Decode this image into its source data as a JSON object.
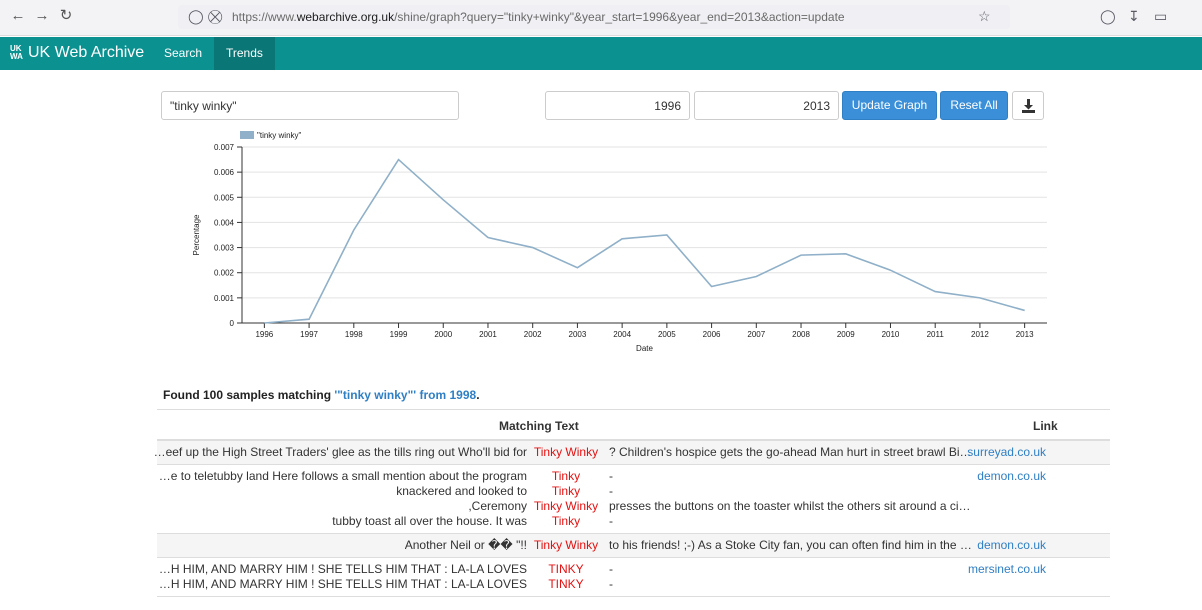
{
  "browser": {
    "url_prefix": "https://www.",
    "url_domain": "webarchive.org.uk",
    "url_suffix": "/shine/graph?query=\"tinky+winky\"&year_start=1996&year_end=2013&action=update"
  },
  "app": {
    "brand": "UK Web Archive",
    "brand_logo": "UK WA",
    "nav": [
      "Search",
      "Trends"
    ]
  },
  "controls": {
    "query": "\"tinky winky\"",
    "year_start": "1996",
    "year_end": "2013",
    "update_label": "Update Graph",
    "reset_label": "Reset All"
  },
  "chart_data": {
    "type": "line",
    "xlabel": "Date",
    "ylabel": "Percentage",
    "ylim": [
      0,
      0.007
    ],
    "yticks": [
      "0",
      "0.001",
      "0.002",
      "0.003",
      "0.004",
      "0.005",
      "0.006",
      "0.007"
    ],
    "categories": [
      "1996",
      "1997",
      "1998",
      "1999",
      "2000",
      "2001",
      "2002",
      "2003",
      "2004",
      "2005",
      "2006",
      "2007",
      "2008",
      "2009",
      "2010",
      "2011",
      "2012",
      "2013"
    ],
    "series": [
      {
        "name": "\"tinky winky\"",
        "color": "#8fb0c8",
        "values": [
          0.0,
          0.00015,
          0.0037,
          0.0065,
          0.0049,
          0.0034,
          0.003,
          0.0022,
          0.00335,
          0.0035,
          0.00145,
          0.00185,
          0.0027,
          0.00275,
          0.0021,
          0.00125,
          0.001,
          0.0005
        ]
      }
    ],
    "grid": true,
    "legend": "top-left"
  },
  "results": {
    "found_prefix": "Found 100 samples matching ",
    "found_query": "'\"tinky winky\"' from 1998",
    "found_suffix": ".",
    "col_text": "Matching Text",
    "col_link": "Link",
    "rows": [
      {
        "link": "surreyad.co.uk",
        "lines": [
          {
            "pre": "…eef up the High Street Traders' glee as the tills ring out Who'll bid for",
            "hit": "Tinky Winky",
            "post": "? Children's hospice gets the go-ahead Man hurt in street brawl Bis…"
          }
        ]
      },
      {
        "link": "demon.co.uk",
        "lines": [
          {
            "pre": "…e to teletubby land Here follows a small mention about the program",
            "hit": "Tinky",
            "post": "-"
          },
          {
            "pre": "knackered and looked to",
            "hit": "Tinky",
            "post": "-"
          },
          {
            "pre": ",Ceremony",
            "hit": "Tinky Winky",
            "post": "presses the buttons on the toaster whilst the others sit around a circ…"
          },
          {
            "pre": "tubby toast all over the house. It was",
            "hit": "Tinky",
            "post": "-"
          }
        ]
      },
      {
        "link": "demon.co.uk",
        "lines": [
          {
            "pre": "Another Neil or �� \"!!",
            "hit": "Tinky Winky",
            "post": "to his friends! ;-) As a Stoke City fan, you can often find him in the E…"
          }
        ]
      },
      {
        "link": "mersinet.co.uk",
        "lines": [
          {
            "pre": "…H HIM, AND MARRY HIM ! SHE TELLS HIM THAT : LA-LA LOVES",
            "hit": "TINKY",
            "post": "-"
          },
          {
            "pre": "…H HIM, AND MARRY HIM ! SHE TELLS HIM THAT : LA-LA LOVES",
            "hit": "TINKY",
            "post": "-"
          }
        ]
      }
    ]
  }
}
